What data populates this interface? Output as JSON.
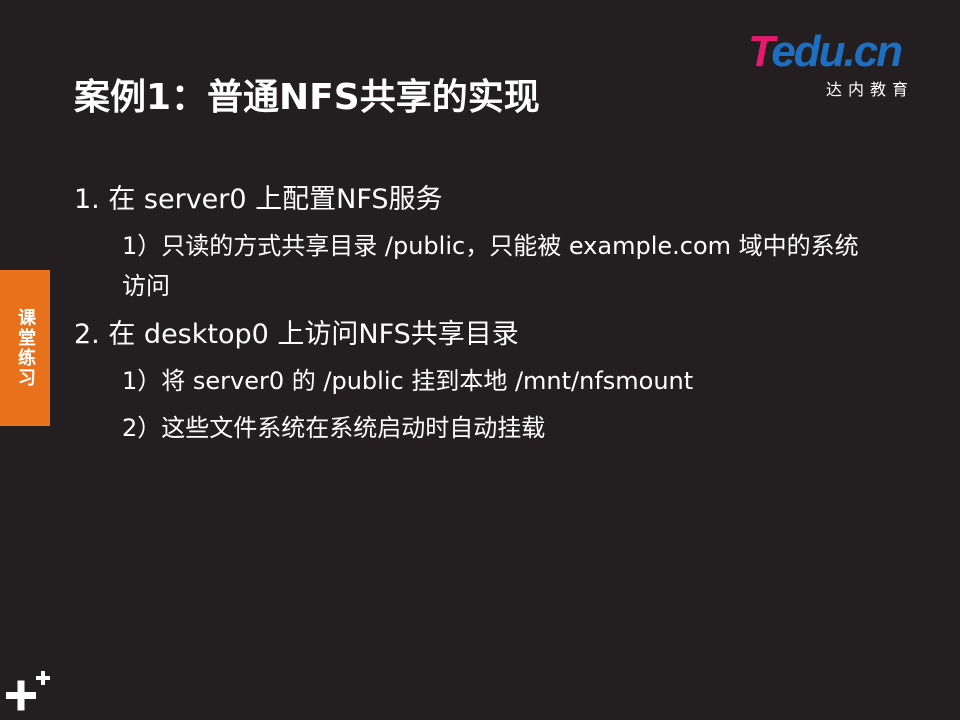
{
  "logo": {
    "first_letter": "T",
    "rest": "edu.cn",
    "subtitle": "达内教育"
  },
  "title": "案例1：普通NFS共享的实现",
  "side_tab": "课堂练习",
  "items": [
    {
      "text": "1. 在 server0 上配置NFS服务"
    },
    {
      "text": "1）只读的方式共享目录 /public，只能被 example.com 域中的系统访问"
    },
    {
      "text": "2. 在 desktop0 上访问NFS共享目录"
    },
    {
      "text": "1）将 server0 的 /public 挂到本地 /mnt/nfsmount"
    },
    {
      "text": "2）这些文件系统在系统启动时自动挂载"
    }
  ],
  "colors": {
    "background": "#231f20",
    "tab": "#e8721c",
    "logo_pink": "#e6196e",
    "logo_blue": "#1d6fc2"
  },
  "icons": {
    "corner": "plus-icon"
  }
}
